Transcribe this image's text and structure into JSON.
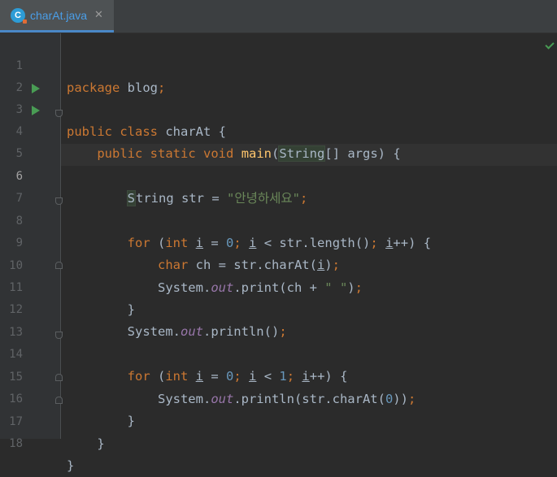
{
  "tab": {
    "label": "charAt.java",
    "close": "✕",
    "icon_letter": "C"
  },
  "line_numbers": [
    "1",
    "2",
    "3",
    "4",
    "5",
    "6",
    "7",
    "8",
    "9",
    "10",
    "11",
    "12",
    "13",
    "14",
    "15",
    "16",
    "17",
    "18"
  ],
  "current_line": 6,
  "code": {
    "l1_kw": "package",
    "l1_rest": " blog",
    "l1_semi": ";",
    "l3_kw1": "public",
    "l3_kw2": "class",
    "l3_rest": " charAt {",
    "l4_kw1": "public",
    "l4_kw2": "static",
    "l4_kw3": "void",
    "l4_fn": "main",
    "l4_p1": "(",
    "l4_type": "String",
    "l4_p2": "[] args) {",
    "l6_s": "S",
    "l6_rest": "tring str = ",
    "l6_str": "\"안녕하세요\"",
    "l6_semi": ";",
    "l8_kw": "for",
    "l8_a": " (",
    "l8_int": "int",
    "l8_sp": " ",
    "l8_i1": "i",
    "l8_b": " = ",
    "l8_zero": "0",
    "l8_semi1": ";",
    "l8_sp2": " ",
    "l8_i2": "i",
    "l8_c": " < str.length()",
    "l8_semi2": ";",
    "l8_sp3": " ",
    "l8_i3": "i",
    "l8_d": "++) {",
    "l9_kw": "char",
    "l9_a": " ch = str.charAt(",
    "l9_i": "i",
    "l9_b": ")",
    "l9_semi": ";",
    "l10_a": "System.",
    "l10_out": "out",
    "l10_b": ".print(ch + ",
    "l10_str": "\" \"",
    "l10_c": ")",
    "l10_semi": ";",
    "l11": "}",
    "l12_a": "System.",
    "l12_out": "out",
    "l12_b": ".println()",
    "l12_semi": ";",
    "l14_kw": "for",
    "l14_a": " (",
    "l14_int": "int",
    "l14_sp": " ",
    "l14_i1": "i",
    "l14_b": " = ",
    "l14_zero": "0",
    "l14_semi1": ";",
    "l14_sp2": " ",
    "l14_i2": "i",
    "l14_c": " < ",
    "l14_one": "1",
    "l14_semi2": ";",
    "l14_sp3": " ",
    "l14_i3": "i",
    "l14_d": "++) {",
    "l15_a": "System.",
    "l15_out": "out",
    "l15_b": ".println(str.charAt(",
    "l15_zero": "0",
    "l15_c": "))",
    "l15_semi": ";",
    "l16": "}",
    "l17": "}",
    "l18": "}"
  },
  "colors": {
    "keyword": "#cc7832",
    "string": "#6a8759",
    "number": "#6897bb",
    "function": "#ffc66d",
    "field": "#9876aa",
    "text": "#a9b7c6",
    "background": "#2b2b2b"
  }
}
